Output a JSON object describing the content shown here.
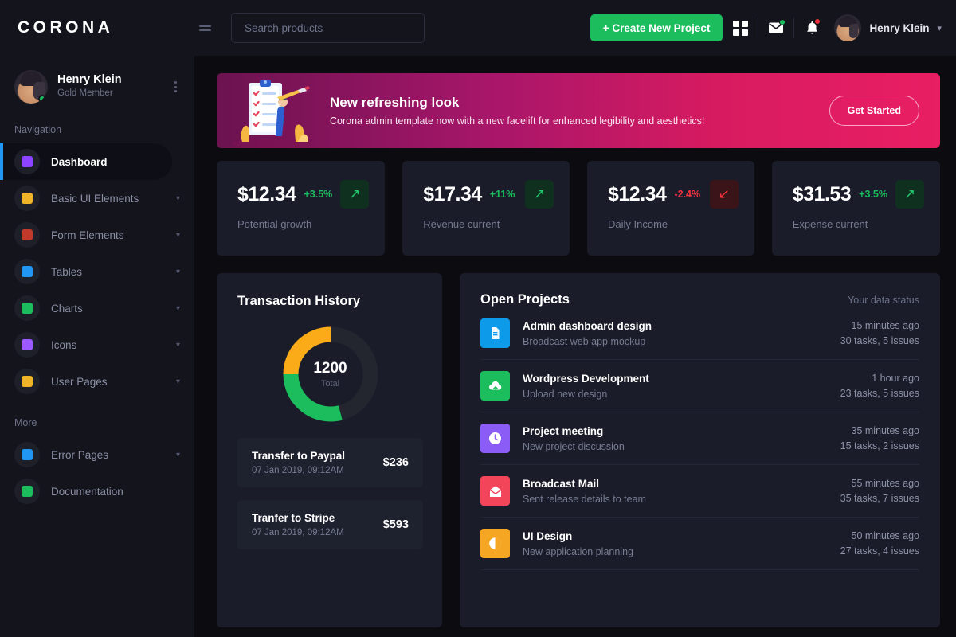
{
  "brand": "CORONA",
  "topbar": {
    "menu_icon": "hamburger-icon",
    "search_placeholder": "Search products",
    "search_value": "",
    "create_button": "+ Create New Project",
    "grid_icon": "grid-apps-icon",
    "mail_icon": "envelope-icon",
    "bell_icon": "bell-icon",
    "user_name": "Henry Klein",
    "caret": "▾"
  },
  "sidebar": {
    "profile": {
      "name": "Henry Klein",
      "role": "Gold Member"
    },
    "section_navigation": "Navigation",
    "section_more": "More",
    "items": [
      {
        "label": "Dashboard",
        "icon": "speedometer-icon",
        "color": "#8e44ff",
        "active": true,
        "chevron": false
      },
      {
        "label": "Basic UI Elements",
        "icon": "window-icon",
        "color": "#f0b429",
        "active": false,
        "chevron": true
      },
      {
        "label": "Form Elements",
        "icon": "form-icon",
        "color": "#c0392b",
        "active": false,
        "chevron": true
      },
      {
        "label": "Tables",
        "icon": "table-icon",
        "color": "#2196f3",
        "active": false,
        "chevron": true
      },
      {
        "label": "Charts",
        "icon": "bar-chart-icon",
        "color": "#1bbd5d",
        "active": false,
        "chevron": true
      },
      {
        "label": "Icons",
        "icon": "emoji-icon",
        "color": "#9b59ff",
        "active": false,
        "chevron": true
      },
      {
        "label": "User Pages",
        "icon": "user-face-icon",
        "color": "#f0b429",
        "active": false,
        "chevron": true
      }
    ],
    "more_items": [
      {
        "label": "Error Pages",
        "icon": "lock-icon",
        "color": "#2196f3",
        "chevron": true
      },
      {
        "label": "Documentation",
        "icon": "document-icon",
        "color": "#1bbd5d",
        "chevron": false
      }
    ]
  },
  "banner": {
    "title": "New refreshing look",
    "subtitle": "Corona admin template now with a new facelift for enhanced legibility and aesthetics!",
    "button": "Get Started",
    "art": "clipboard-checklist-illustration"
  },
  "stats": [
    {
      "value": "$12.34",
      "delta": "+3.5%",
      "direction": "up",
      "label": "Potential growth"
    },
    {
      "value": "$17.34",
      "delta": "+11%",
      "direction": "up",
      "label": "Revenue current"
    },
    {
      "value": "$12.34",
      "delta": "-2.4%",
      "direction": "down",
      "label": "Daily Income"
    },
    {
      "value": "$31.53",
      "delta": "+3.5%",
      "direction": "up",
      "label": "Expense current"
    }
  ],
  "transactions": {
    "title": "Transaction History",
    "chart_data": {
      "type": "pie",
      "title": "Transaction History",
      "center_value": "1200",
      "center_label": "Total",
      "categories": [
        "Orange segment",
        "Green segment",
        "Remaining"
      ],
      "values": [
        25,
        29,
        46
      ],
      "colors": [
        "#fbab18",
        "#1bbd5d",
        "#23252f"
      ],
      "legend": "none",
      "grid": false
    },
    "items": [
      {
        "title": "Transfer to Paypal",
        "date": "07 Jan 2019, 09:12AM",
        "amount": "$236"
      },
      {
        "title": "Tranfer to Stripe",
        "date": "07 Jan 2019, 09:12AM",
        "amount": "$593"
      }
    ]
  },
  "projects": {
    "title": "Open Projects",
    "meta": "Your data status",
    "rows": [
      {
        "name": "Admin dashboard design",
        "desc": "Broadcast web app mockup",
        "time": "15 minutes ago",
        "tasks": "30 tasks, 5 issues",
        "icon": "file-icon",
        "color": "#0d9ae8"
      },
      {
        "name": "Wordpress Development",
        "desc": "Upload new design",
        "time": "1 hour ago",
        "tasks": "23 tasks, 5 issues",
        "icon": "cloud-upload-icon",
        "color": "#1bbd5d"
      },
      {
        "name": "Project meeting",
        "desc": "New project discussion",
        "time": "35 minutes ago",
        "tasks": "15 tasks, 2 issues",
        "icon": "clock-icon",
        "color": "#8b5cf6"
      },
      {
        "name": "Broadcast Mail",
        "desc": "Sent release details to team",
        "time": "55 minutes ago",
        "tasks": "35 tasks, 7 issues",
        "icon": "mail-open-icon",
        "color": "#f2455a"
      },
      {
        "name": "UI Design",
        "desc": "New application planning",
        "time": "50 minutes ago",
        "tasks": "27 tasks, 4 issues",
        "icon": "pie-chart-icon",
        "color": "#f5a623"
      }
    ]
  }
}
